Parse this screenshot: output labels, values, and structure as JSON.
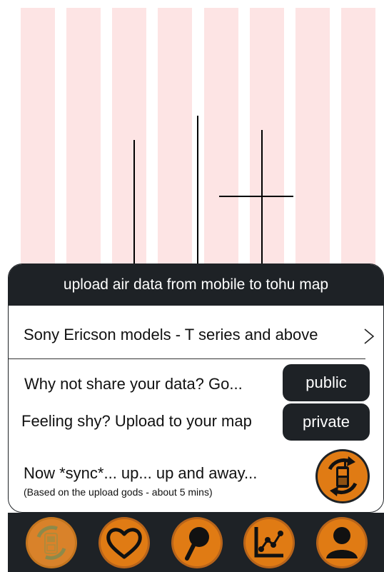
{
  "header": {
    "title": "upload air data from mobile to tohu map"
  },
  "models": {
    "label": "Sony Ericson models - T series and above"
  },
  "share": {
    "public_prompt": "Why not share your data? Go...",
    "public_button": "public",
    "private_prompt": "Feeling shy? Upload to your map",
    "private_button": "private"
  },
  "sync": {
    "label": "Now *sync*... up... up and away...",
    "note": "(Based on the upload gods - about 5 mins)"
  },
  "icons": {
    "models_chevron": "chevron-right-icon",
    "sync": "sync-phone-icon",
    "nav": [
      "mobile-sync-icon",
      "heart-icon",
      "map-pin-icon",
      "chart-icon",
      "user-icon"
    ]
  },
  "colors": {
    "accent": "#e07b14",
    "dark": "#1e2226",
    "stripe": "#fde4e4"
  }
}
